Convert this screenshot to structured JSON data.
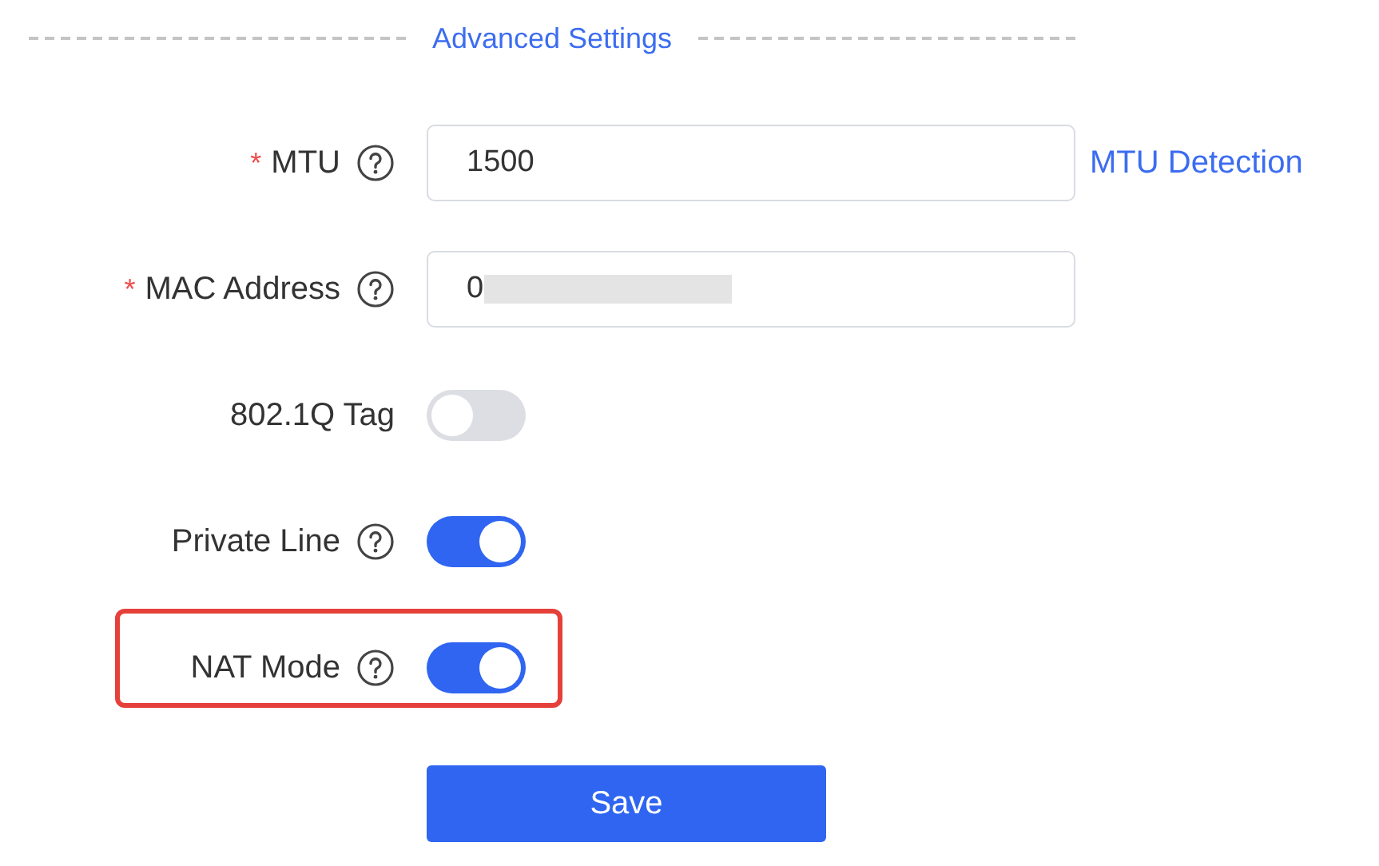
{
  "section_title": "Advanced Settings",
  "fields": [
    {
      "kind": "input",
      "required_mark": "*",
      "label": "MTU",
      "help": true,
      "value": "1500",
      "link": "MTU Detection",
      "highlighted": false
    },
    {
      "kind": "input",
      "required_mark": "*",
      "label": "MAC Address",
      "help": true,
      "value": "0",
      "redacted": true,
      "highlighted": false
    },
    {
      "kind": "switch",
      "label": "802.1Q Tag",
      "help": false,
      "on": false,
      "highlighted": false
    },
    {
      "kind": "switch",
      "label": "Private Line",
      "help": true,
      "on": true,
      "highlighted": false
    },
    {
      "kind": "switch",
      "label": "NAT Mode",
      "help": true,
      "on": true,
      "highlighted": true
    }
  ],
  "save_button": "Save"
}
